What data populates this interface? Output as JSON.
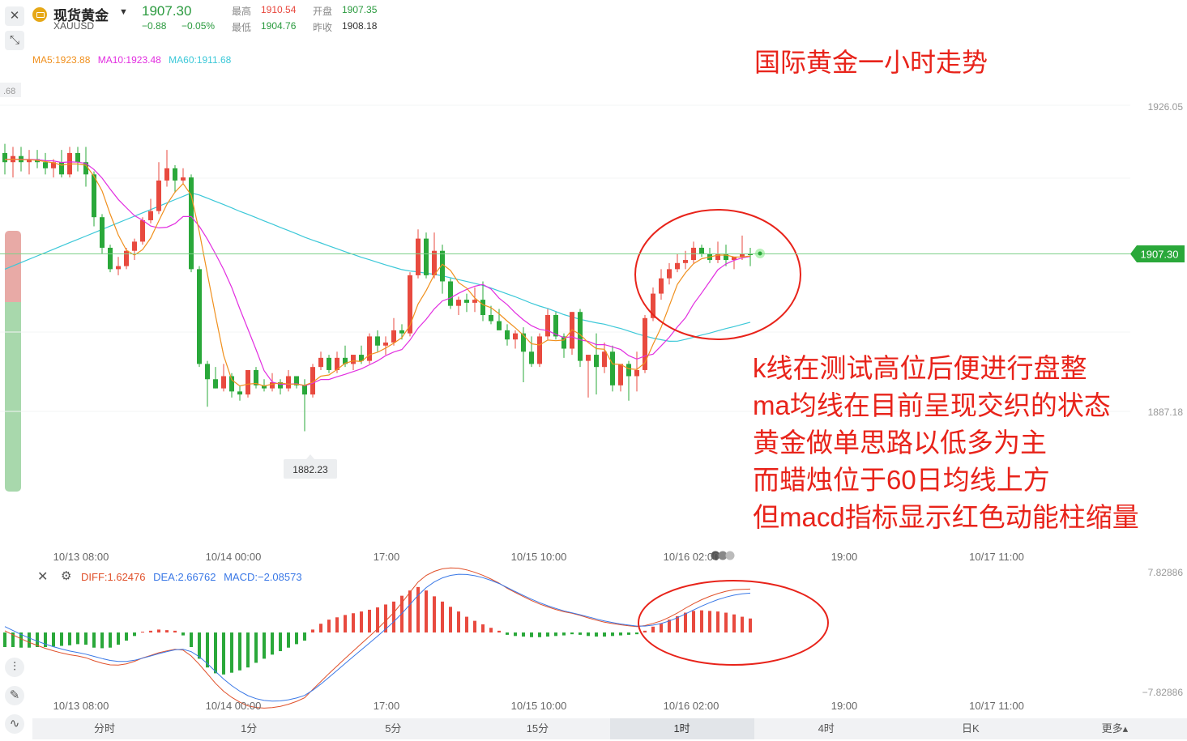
{
  "header": {
    "symbol_name": "现货黄金",
    "symbol_code": "XAUUSD",
    "last_price": "1907.30",
    "change": "−0.88",
    "change_pct": "−0.05%",
    "high_label": "最高",
    "high_value": "1910.54",
    "open_label": "开盘",
    "open_value": "1907.35",
    "low_label": "最低",
    "low_value": "1904.76",
    "prev_close_label": "昨收",
    "prev_close_value": "1908.18"
  },
  "ma_legend": {
    "ma5": "MA5:1923.88",
    "ma10": "MA10:1923.48",
    "ma60": "MA60:1911.68"
  },
  "chart_title": "国际黄金一小时走势",
  "annotations": [
    "k线在测试高位后便进行盘整",
    "ma均线在目前呈现交织的状态",
    "黄金做单思路以低多为主",
    "而蜡烛位于60日均线上方",
    "但macd指标显示红色动能柱缩量"
  ],
  "price_axis": {
    "top_label": "1926.05",
    "bottom_label": "1887.18",
    "left_partial": ".68",
    "current_tag": "1907.30"
  },
  "low_marker": "1882.23",
  "macd_legend": {
    "diff": "DIFF:1.62476",
    "dea": "DEA:2.66762",
    "macd": "MACD:−2.08573"
  },
  "macd_axis": {
    "top": "7.82886",
    "bottom": "−7.82886"
  },
  "time_labels_main": [
    "10/13 08:00",
    "10/14 00:00",
    "17:00",
    "10/15 10:00",
    "10/16 02:00",
    "19:00",
    "10/17 11:00"
  ],
  "time_labels_macd": [
    "10/13 08:00",
    "10/14 00:00",
    "17:00",
    "10/15 10:00",
    "10/16 02:00",
    "19:00",
    "10/17 11:00"
  ],
  "tabs": [
    "分时",
    "1分",
    "5分",
    "15分",
    "1时",
    "4时",
    "日K",
    "更多▴"
  ],
  "active_tab": "1时",
  "colors": {
    "up": "#e84a3f",
    "down": "#2aa83a",
    "ma5": "#f0901e",
    "ma10": "#e22ee0",
    "ma60": "#3cc8d8",
    "diff": "#e0502a",
    "dea": "#3a78e6",
    "annotation": "#e8231a"
  },
  "chart_data": {
    "type": "candlestick",
    "timeframe": "1时",
    "ylim": [
      1880,
      1930
    ],
    "candles": [
      {
        "o": 1924.0,
        "h": 1925.5,
        "l": 1920.5,
        "c": 1922.5
      },
      {
        "o": 1922.5,
        "h": 1925.0,
        "l": 1920.0,
        "c": 1923.5
      },
      {
        "o": 1923.5,
        "h": 1925.0,
        "l": 1921.0,
        "c": 1922.5
      },
      {
        "o": 1922.5,
        "h": 1924.5,
        "l": 1920.5,
        "c": 1923.0
      },
      {
        "o": 1923.0,
        "h": 1924.5,
        "l": 1921.5,
        "c": 1922.5
      },
      {
        "o": 1922.5,
        "h": 1924.0,
        "l": 1920.5,
        "c": 1921.5
      },
      {
        "o": 1921.5,
        "h": 1923.0,
        "l": 1920.0,
        "c": 1922.5
      },
      {
        "o": 1922.5,
        "h": 1924.5,
        "l": 1920.0,
        "c": 1920.5
      },
      {
        "o": 1920.5,
        "h": 1925.0,
        "l": 1920.0,
        "c": 1924.0
      },
      {
        "o": 1924.0,
        "h": 1925.0,
        "l": 1921.0,
        "c": 1922.5
      },
      {
        "o": 1922.5,
        "h": 1925.0,
        "l": 1918.5,
        "c": 1920.5
      },
      {
        "o": 1920.5,
        "h": 1921.0,
        "l": 1912.0,
        "c": 1913.5
      },
      {
        "o": 1913.5,
        "h": 1914.0,
        "l": 1907.5,
        "c": 1908.5
      },
      {
        "o": 1908.5,
        "h": 1909.0,
        "l": 1904.5,
        "c": 1905.0
      },
      {
        "o": 1905.0,
        "h": 1907.0,
        "l": 1904.0,
        "c": 1905.5
      },
      {
        "o": 1905.5,
        "h": 1908.5,
        "l": 1905.0,
        "c": 1908.0
      },
      {
        "o": 1908.0,
        "h": 1910.0,
        "l": 1906.5,
        "c": 1909.5
      },
      {
        "o": 1909.5,
        "h": 1913.5,
        "l": 1909.0,
        "c": 1913.0
      },
      {
        "o": 1913.0,
        "h": 1916.5,
        "l": 1912.5,
        "c": 1914.5
      },
      {
        "o": 1914.5,
        "h": 1922.5,
        "l": 1914.0,
        "c": 1919.5
      },
      {
        "o": 1919.5,
        "h": 1924.5,
        "l": 1918.5,
        "c": 1921.5
      },
      {
        "o": 1921.5,
        "h": 1922.0,
        "l": 1917.5,
        "c": 1919.5
      },
      {
        "o": 1919.5,
        "h": 1921.5,
        "l": 1919.0,
        "c": 1920.0
      },
      {
        "o": 1920.0,
        "h": 1920.5,
        "l": 1904.5,
        "c": 1905.0
      },
      {
        "o": 1905.0,
        "h": 1905.5,
        "l": 1889.0,
        "c": 1889.5
      },
      {
        "o": 1889.5,
        "h": 1890.0,
        "l": 1882.5,
        "c": 1887.0
      },
      {
        "o": 1887.0,
        "h": 1889.0,
        "l": 1885.5,
        "c": 1885.5
      },
      {
        "o": 1885.5,
        "h": 1889.5,
        "l": 1885.0,
        "c": 1887.5
      },
      {
        "o": 1887.5,
        "h": 1888.0,
        "l": 1884.0,
        "c": 1885.0
      },
      {
        "o": 1885.0,
        "h": 1886.0,
        "l": 1883.5,
        "c": 1884.5
      },
      {
        "o": 1884.5,
        "h": 1888.5,
        "l": 1884.0,
        "c": 1888.5
      },
      {
        "o": 1888.5,
        "h": 1889.0,
        "l": 1885.5,
        "c": 1886.0
      },
      {
        "o": 1886.0,
        "h": 1887.0,
        "l": 1885.0,
        "c": 1885.5
      },
      {
        "o": 1885.5,
        "h": 1888.0,
        "l": 1885.0,
        "c": 1886.5
      },
      {
        "o": 1886.5,
        "h": 1887.0,
        "l": 1884.5,
        "c": 1885.5
      },
      {
        "o": 1885.5,
        "h": 1888.5,
        "l": 1885.0,
        "c": 1887.5
      },
      {
        "o": 1887.5,
        "h": 1887.5,
        "l": 1885.5,
        "c": 1886.0
      },
      {
        "o": 1886.0,
        "h": 1887.0,
        "l": 1878.5,
        "c": 1884.5
      },
      {
        "o": 1884.5,
        "h": 1889.5,
        "l": 1884.0,
        "c": 1889.0
      },
      {
        "o": 1889.0,
        "h": 1891.5,
        "l": 1888.5,
        "c": 1890.5
      },
      {
        "o": 1890.5,
        "h": 1891.0,
        "l": 1888.0,
        "c": 1888.5
      },
      {
        "o": 1888.5,
        "h": 1891.5,
        "l": 1888.0,
        "c": 1890.5
      },
      {
        "o": 1890.5,
        "h": 1892.5,
        "l": 1889.0,
        "c": 1889.5
      },
      {
        "o": 1889.5,
        "h": 1891.0,
        "l": 1888.5,
        "c": 1891.0
      },
      {
        "o": 1891.0,
        "h": 1892.5,
        "l": 1889.5,
        "c": 1890.0
      },
      {
        "o": 1890.0,
        "h": 1894.5,
        "l": 1889.5,
        "c": 1894.0
      },
      {
        "o": 1894.0,
        "h": 1895.0,
        "l": 1891.5,
        "c": 1892.5
      },
      {
        "o": 1892.5,
        "h": 1894.0,
        "l": 1891.0,
        "c": 1893.0
      },
      {
        "o": 1893.0,
        "h": 1897.0,
        "l": 1892.5,
        "c": 1895.0
      },
      {
        "o": 1895.0,
        "h": 1896.0,
        "l": 1893.5,
        "c": 1894.5
      },
      {
        "o": 1894.5,
        "h": 1904.5,
        "l": 1894.0,
        "c": 1904.0
      },
      {
        "o": 1904.0,
        "h": 1911.5,
        "l": 1903.5,
        "c": 1910.0
      },
      {
        "o": 1910.0,
        "h": 1911.0,
        "l": 1903.5,
        "c": 1904.0
      },
      {
        "o": 1904.0,
        "h": 1911.0,
        "l": 1903.5,
        "c": 1908.0
      },
      {
        "o": 1908.0,
        "h": 1909.0,
        "l": 1901.0,
        "c": 1903.0
      },
      {
        "o": 1903.0,
        "h": 1903.5,
        "l": 1898.5,
        "c": 1899.0
      },
      {
        "o": 1899.0,
        "h": 1900.5,
        "l": 1897.5,
        "c": 1900.0
      },
      {
        "o": 1900.0,
        "h": 1901.0,
        "l": 1898.0,
        "c": 1899.5
      },
      {
        "o": 1899.5,
        "h": 1902.0,
        "l": 1898.0,
        "c": 1900.0
      },
      {
        "o": 1900.0,
        "h": 1903.0,
        "l": 1896.5,
        "c": 1897.5
      },
      {
        "o": 1897.5,
        "h": 1899.0,
        "l": 1896.0,
        "c": 1896.5
      },
      {
        "o": 1896.5,
        "h": 1898.5,
        "l": 1895.5,
        "c": 1895.0
      },
      {
        "o": 1895.0,
        "h": 1896.0,
        "l": 1892.5,
        "c": 1893.5
      },
      {
        "o": 1893.5,
        "h": 1895.0,
        "l": 1892.0,
        "c": 1894.5
      },
      {
        "o": 1894.5,
        "h": 1895.5,
        "l": 1886.5,
        "c": 1891.5
      },
      {
        "o": 1891.5,
        "h": 1894.0,
        "l": 1889.0,
        "c": 1889.5
      },
      {
        "o": 1889.5,
        "h": 1894.5,
        "l": 1889.0,
        "c": 1894.0
      },
      {
        "o": 1894.0,
        "h": 1898.5,
        "l": 1893.5,
        "c": 1897.5
      },
      {
        "o": 1897.5,
        "h": 1898.0,
        "l": 1893.5,
        "c": 1894.0
      },
      {
        "o": 1894.0,
        "h": 1894.5,
        "l": 1890.5,
        "c": 1892.0
      },
      {
        "o": 1892.0,
        "h": 1898.0,
        "l": 1891.0,
        "c": 1898.0
      },
      {
        "o": 1898.0,
        "h": 1898.5,
        "l": 1889.0,
        "c": 1890.0
      },
      {
        "o": 1890.0,
        "h": 1891.0,
        "l": 1884.0,
        "c": 1891.0
      },
      {
        "o": 1891.0,
        "h": 1894.5,
        "l": 1884.5,
        "c": 1889.0
      },
      {
        "o": 1889.0,
        "h": 1893.0,
        "l": 1888.0,
        "c": 1891.5
      },
      {
        "o": 1891.5,
        "h": 1892.5,
        "l": 1885.0,
        "c": 1886.0
      },
      {
        "o": 1886.0,
        "h": 1887.0,
        "l": 1885.0,
        "c": 1889.5
      },
      {
        "o": 1889.5,
        "h": 1890.0,
        "l": 1883.5,
        "c": 1887.5
      },
      {
        "o": 1887.5,
        "h": 1891.5,
        "l": 1885.0,
        "c": 1888.5
      },
      {
        "o": 1888.5,
        "h": 1897.5,
        "l": 1888.0,
        "c": 1897.0
      },
      {
        "o": 1897.0,
        "h": 1902.0,
        "l": 1896.5,
        "c": 1901.0
      },
      {
        "o": 1901.0,
        "h": 1905.0,
        "l": 1900.0,
        "c": 1903.5
      },
      {
        "o": 1903.5,
        "h": 1906.0,
        "l": 1902.5,
        "c": 1905.0
      },
      {
        "o": 1905.0,
        "h": 1907.5,
        "l": 1904.5,
        "c": 1906.0
      },
      {
        "o": 1906.0,
        "h": 1908.0,
        "l": 1905.0,
        "c": 1906.5
      },
      {
        "o": 1906.5,
        "h": 1909.5,
        "l": 1906.0,
        "c": 1908.5
      },
      {
        "o": 1908.5,
        "h": 1909.0,
        "l": 1907.0,
        "c": 1907.5
      },
      {
        "o": 1907.5,
        "h": 1908.5,
        "l": 1906.0,
        "c": 1906.5
      },
      {
        "o": 1906.5,
        "h": 1909.5,
        "l": 1906.0,
        "c": 1907.5
      },
      {
        "o": 1907.5,
        "h": 1909.0,
        "l": 1905.5,
        "c": 1906.5
      },
      {
        "o": 1906.5,
        "h": 1907.0,
        "l": 1905.0,
        "c": 1907.0
      },
      {
        "o": 1907.0,
        "h": 1910.5,
        "l": 1906.5,
        "c": 1907.5
      },
      {
        "o": 1907.5,
        "h": 1908.5,
        "l": 1905.5,
        "c": 1907.3
      }
    ],
    "macd_hist": [
      -2.5,
      -2.5,
      -2.6,
      -2.6,
      -2.5,
      -2.5,
      -2.4,
      -2.3,
      -2.2,
      -2.0,
      -2.1,
      -2.6,
      -2.7,
      -2.6,
      -2.1,
      -1.4,
      -0.6,
      0.1,
      0.3,
      0.5,
      0.4,
      0.3,
      -0.5,
      -2.5,
      -4.5,
      -6.0,
      -7.0,
      -7.2,
      -6.9,
      -6.5,
      -6.0,
      -5.2,
      -4.5,
      -3.8,
      -3.2,
      -2.6,
      -2.0,
      -1.4,
      0.5,
      1.5,
      2.2,
      2.6,
      3.0,
      3.3,
      3.6,
      3.9,
      4.3,
      4.8,
      5.3,
      6.3,
      7.2,
      7.8,
      7.2,
      6.2,
      5.3,
      4.4,
      3.6,
      2.7,
      2.0,
      1.4,
      0.8,
      0.3,
      -0.4,
      -0.6,
      -0.7,
      -0.8,
      -0.8,
      -0.7,
      -0.6,
      -0.5,
      -0.3,
      -0.4,
      -0.6,
      -0.7,
      -0.7,
      -0.6,
      -0.5,
      -0.4,
      -0.3,
      0.3,
      1.0,
      1.5,
      2.2,
      2.8,
      3.4,
      3.7,
      3.8,
      3.7,
      3.6,
      3.4,
      3.1,
      2.7,
      2.4
    ],
    "xlabel": "",
    "ylabel": ""
  }
}
